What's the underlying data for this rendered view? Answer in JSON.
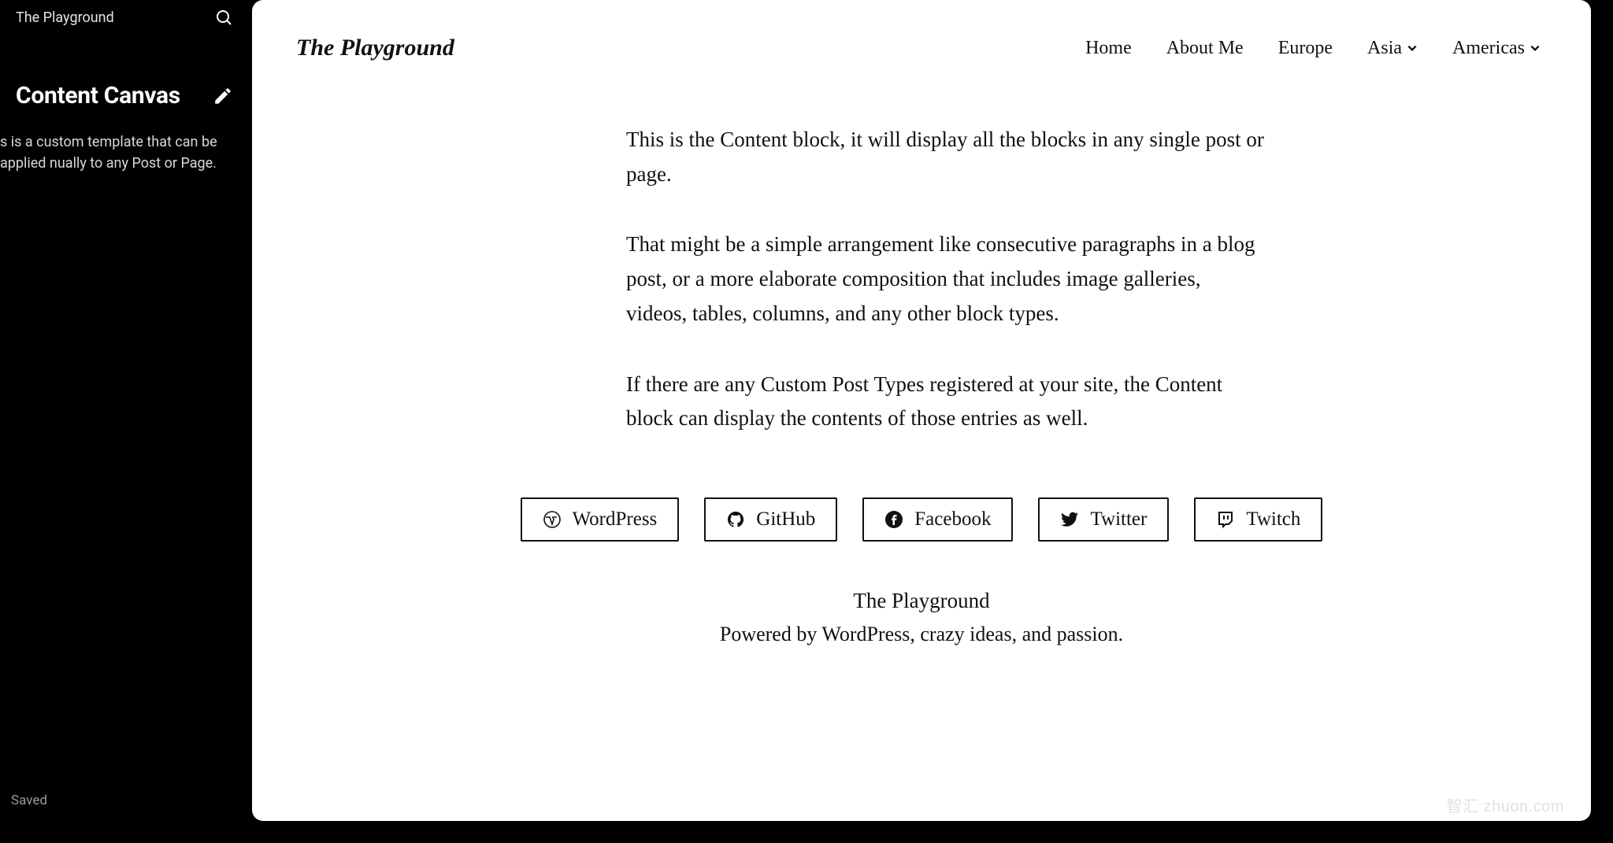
{
  "sidebar": {
    "top_title": "The Playground",
    "heading": "Content Canvas",
    "description": "s is a custom template that can be applied nually to any Post or Page.",
    "status": "Saved"
  },
  "site": {
    "title": "The Playground",
    "nav": {
      "home": "Home",
      "about": "About Me",
      "europe": "Europe",
      "asia": "Asia",
      "americas": "Americas"
    }
  },
  "content": {
    "p1": "This is the Content block, it will display all the blocks in any single post or page.",
    "p2": "That might be a simple arrangement like consecutive paragraphs in a blog post, or a more elaborate composition that includes image galleries, videos, tables, columns, and any other block types.",
    "p3": "If there are any Custom Post Types registered at your site, the Content block can display the contents of those entries as well."
  },
  "social": {
    "wordpress": "WordPress",
    "github": "GitHub",
    "facebook": "Facebook",
    "twitter": "Twitter",
    "twitch": "Twitch"
  },
  "footer": {
    "title": "The Playground",
    "tagline": "Powered by WordPress, crazy ideas, and passion."
  },
  "watermark": "智汇 zhuon.com"
}
